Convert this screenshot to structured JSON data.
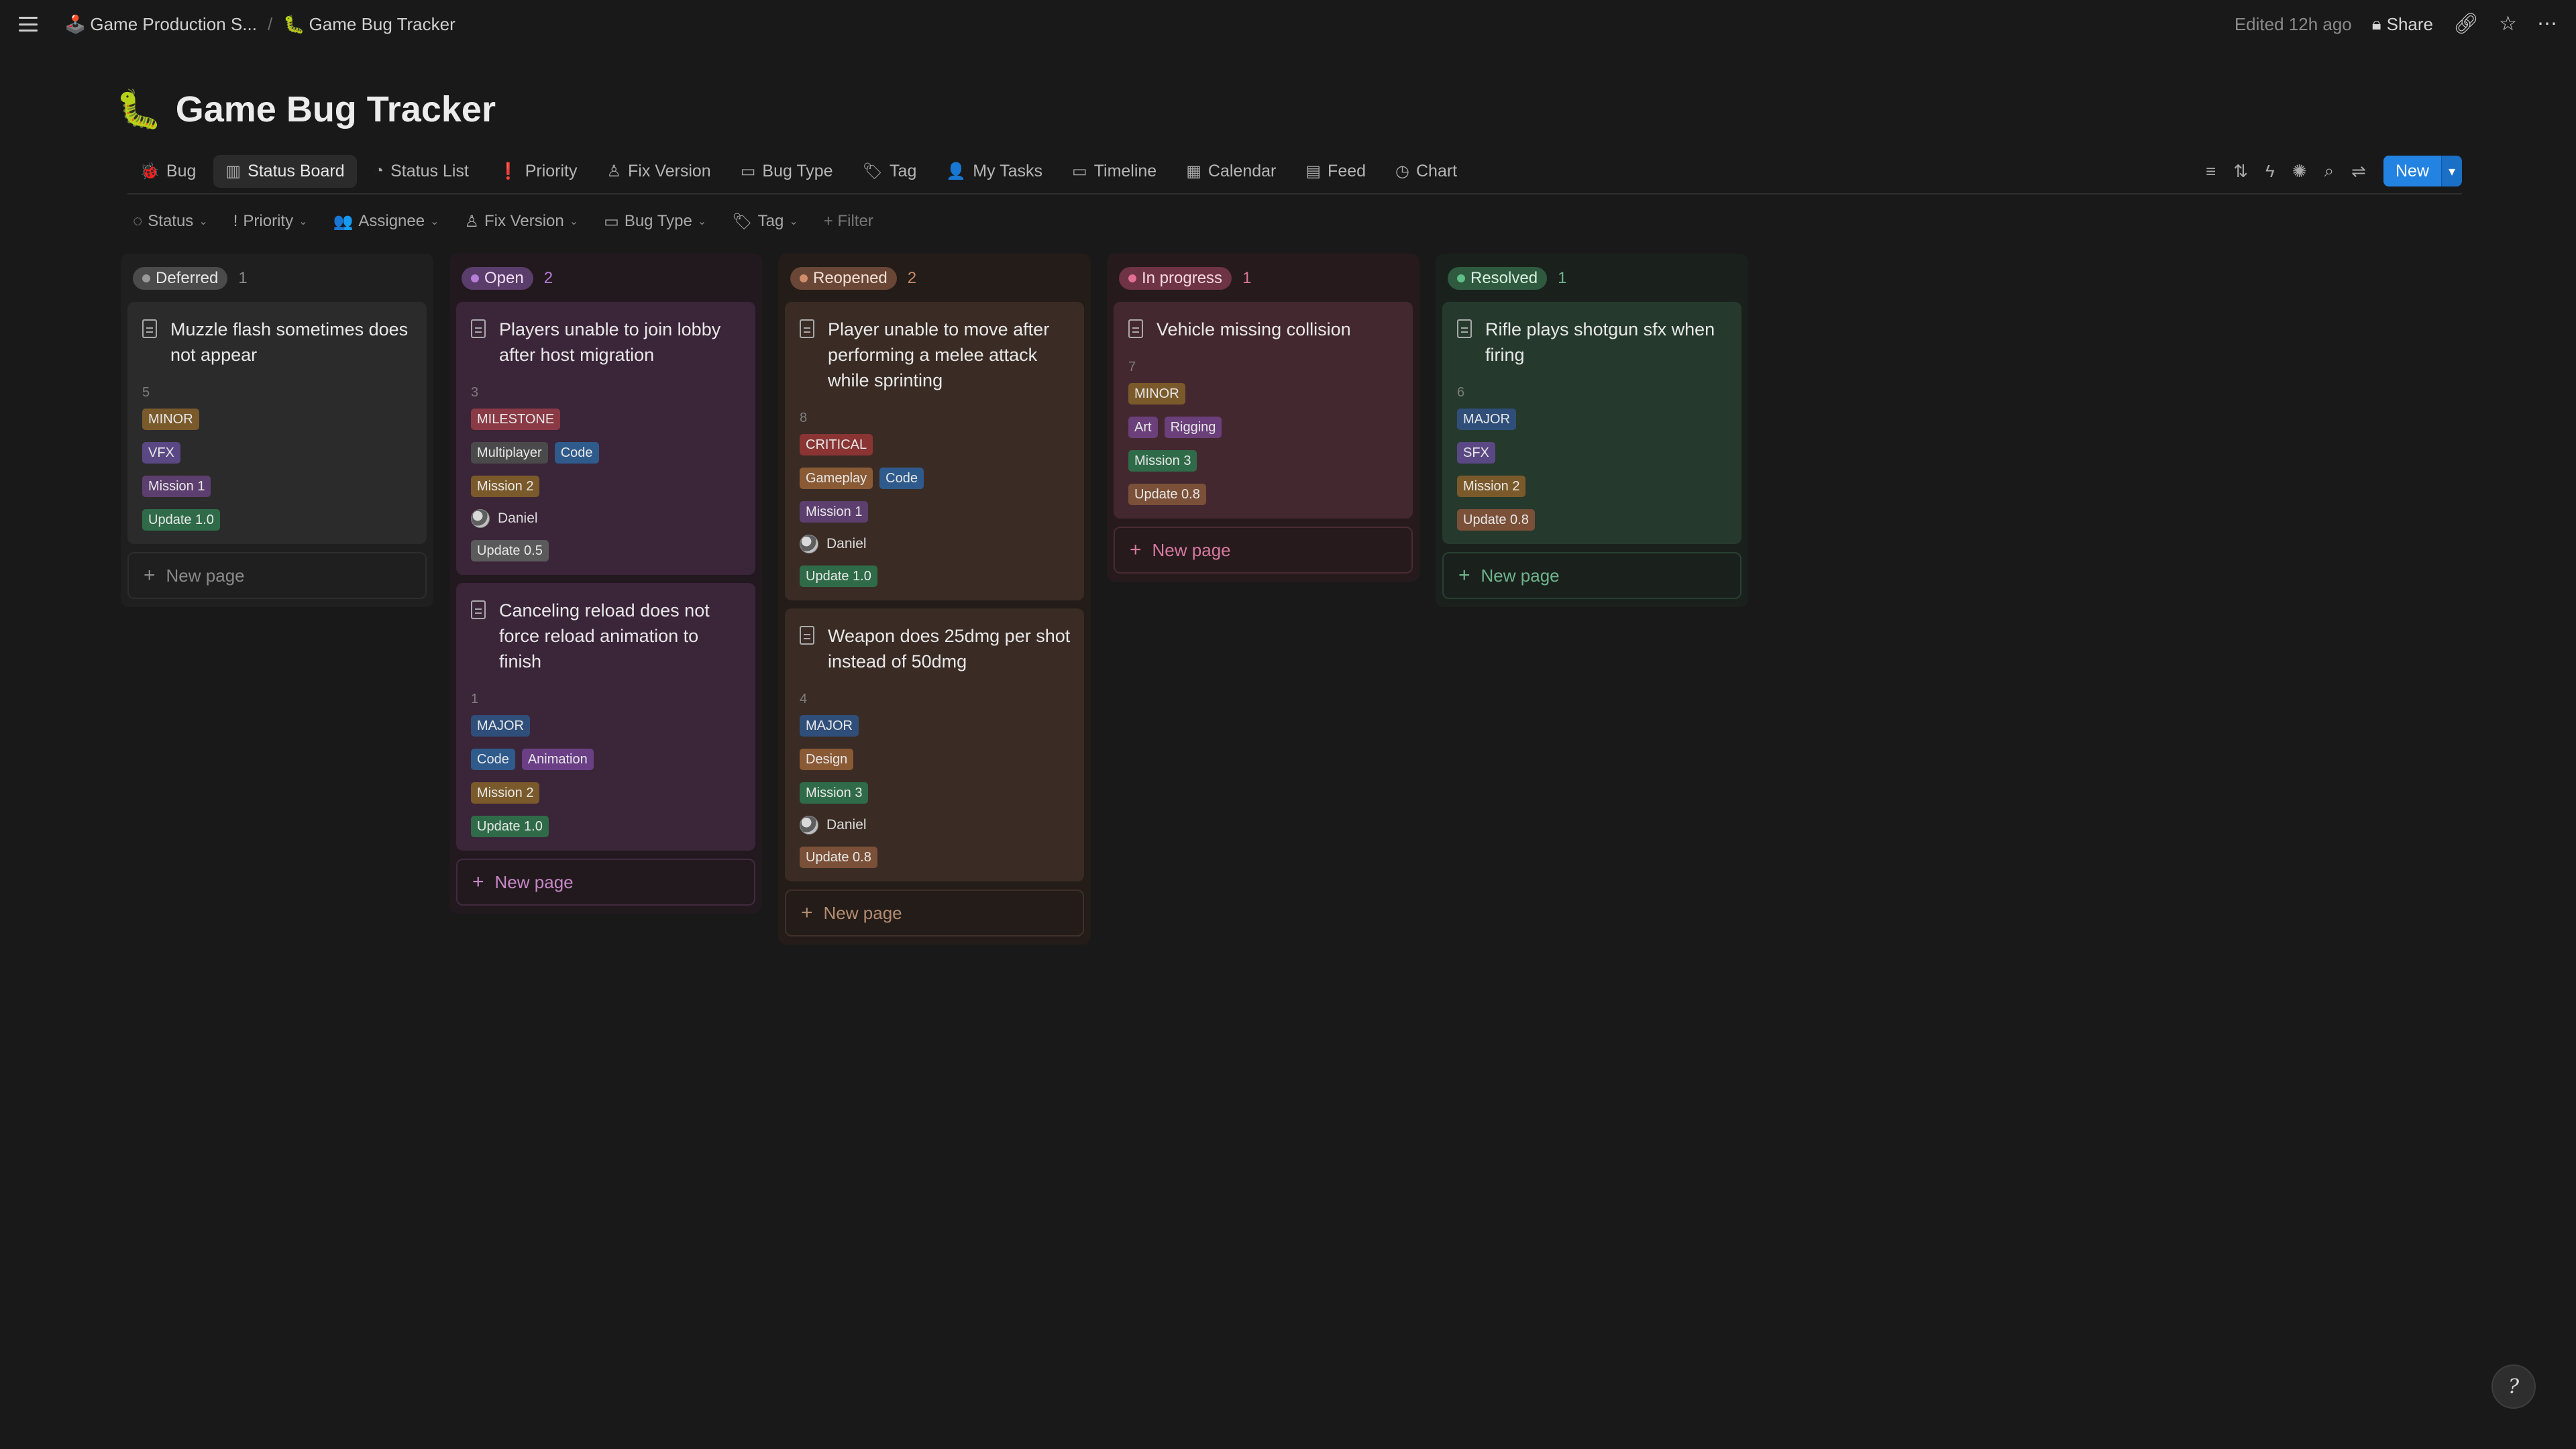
{
  "breadcrumb": {
    "parent": {
      "emoji": "🕹️",
      "label": "Game Production S..."
    },
    "current": {
      "emoji": "🐛",
      "label": "Game Bug Tracker"
    }
  },
  "topbar": {
    "edited": "Edited 12h ago",
    "share": "Share"
  },
  "page": {
    "emoji": "🐛",
    "title": "Game Bug Tracker"
  },
  "views": [
    {
      "label": "Bug",
      "icon": "🐞",
      "active": false
    },
    {
      "label": "Status Board",
      "icon": "▥",
      "active": true
    },
    {
      "label": "Status List",
      "icon": "◔",
      "active": false
    },
    {
      "label": "Priority",
      "icon": "❗",
      "active": false
    },
    {
      "label": "Fix Version",
      "icon": "♙",
      "active": false
    },
    {
      "label": "Bug Type",
      "icon": "▭",
      "active": false
    },
    {
      "label": "Tag",
      "icon": "🏷",
      "active": false
    },
    {
      "label": "My Tasks",
      "icon": "👤",
      "active": false
    },
    {
      "label": "Timeline",
      "icon": "▭",
      "active": false
    },
    {
      "label": "Calendar",
      "icon": "▦",
      "active": false
    },
    {
      "label": "Feed",
      "icon": "▤",
      "active": false
    },
    {
      "label": "Chart",
      "icon": "◷",
      "active": false
    }
  ],
  "toolbar": {
    "new_label": "New"
  },
  "filters": [
    {
      "label": "Status",
      "icon": "◌"
    },
    {
      "label": "Priority",
      "icon": "!"
    },
    {
      "label": "Assignee",
      "icon": "👥"
    },
    {
      "label": "Fix Version",
      "icon": "♙"
    },
    {
      "label": "Bug Type",
      "icon": "▭"
    },
    {
      "label": "Tag",
      "icon": "🏷"
    }
  ],
  "add_filter": "+ Filter",
  "new_page_label": "New page",
  "tag_colors": {
    "MINOR": "#7a5a2b",
    "MAJOR": "#2f4f7a",
    "CRITICAL": "#8a3434",
    "MILESTONE": "#8a3a45",
    "VFX": "#5a4884",
    "SFX": "#5a4884",
    "Code": "#2f5a8c",
    "Animation": "#6a3f86",
    "Multiplayer": "#4a4a4a",
    "Gameplay": "#8a5a35",
    "Art": "#6a3f7a",
    "Rigging": "#6a3f7a",
    "Design": "#8a5a35",
    "Mission 1": "#5c3f6e",
    "Mission 2": "#7a5a2b",
    "Mission 3": "#2f6b48",
    "Update 1.0": "#2f6b48",
    "Update 0.5": "#5a5a5a",
    "Update 0.8": "#7a5038"
  },
  "columns": [
    {
      "key": "def",
      "status": "Deferred",
      "count": "1",
      "cards": [
        {
          "title": "Muzzle flash sometimes does not appear",
          "num": "5",
          "severity": "MINOR",
          "types": [
            "VFX"
          ],
          "mission": "Mission 1",
          "assignee": "",
          "version": "Update 1.0"
        }
      ]
    },
    {
      "key": "open",
      "status": "Open",
      "count": "2",
      "cards": [
        {
          "title": "Players unable to join lobby after host migration",
          "num": "3",
          "severity": "MILESTONE",
          "types": [
            "Multiplayer",
            "Code"
          ],
          "mission": "Mission 2",
          "assignee": "Daniel",
          "version": "Update 0.5"
        },
        {
          "title": "Canceling reload does not force reload animation to finish",
          "num": "1",
          "severity": "MAJOR",
          "types": [
            "Code",
            "Animation"
          ],
          "mission": "Mission 2",
          "assignee": "",
          "version": "Update 1.0"
        }
      ]
    },
    {
      "key": "reo",
      "status": "Reopened",
      "count": "2",
      "cards": [
        {
          "title": "Player unable to move after performing a melee attack while sprinting",
          "num": "8",
          "severity": "CRITICAL",
          "types": [
            "Gameplay",
            "Code"
          ],
          "mission": "Mission 1",
          "assignee": "Daniel",
          "version": "Update 1.0"
        },
        {
          "title": "Weapon does 25dmg per shot instead of 50dmg",
          "num": "4",
          "severity": "MAJOR",
          "types": [
            "Design"
          ],
          "mission": "Mission 3",
          "assignee": "Daniel",
          "version": "Update 0.8"
        }
      ]
    },
    {
      "key": "prog",
      "status": "In progress",
      "count": "1",
      "cards": [
        {
          "title": "Vehicle missing collision",
          "num": "7",
          "severity": "MINOR",
          "types": [
            "Art",
            "Rigging"
          ],
          "mission": "Mission 3",
          "assignee": "",
          "version": "Update 0.8"
        }
      ]
    },
    {
      "key": "res",
      "status": "Resolved",
      "count": "1",
      "cards": [
        {
          "title": "Rifle plays shotgun sfx when firing",
          "num": "6",
          "severity": "MAJOR",
          "types": [
            "SFX"
          ],
          "mission": "Mission 2",
          "assignee": "",
          "version": "Update 0.8"
        }
      ]
    }
  ],
  "help_label": "?"
}
